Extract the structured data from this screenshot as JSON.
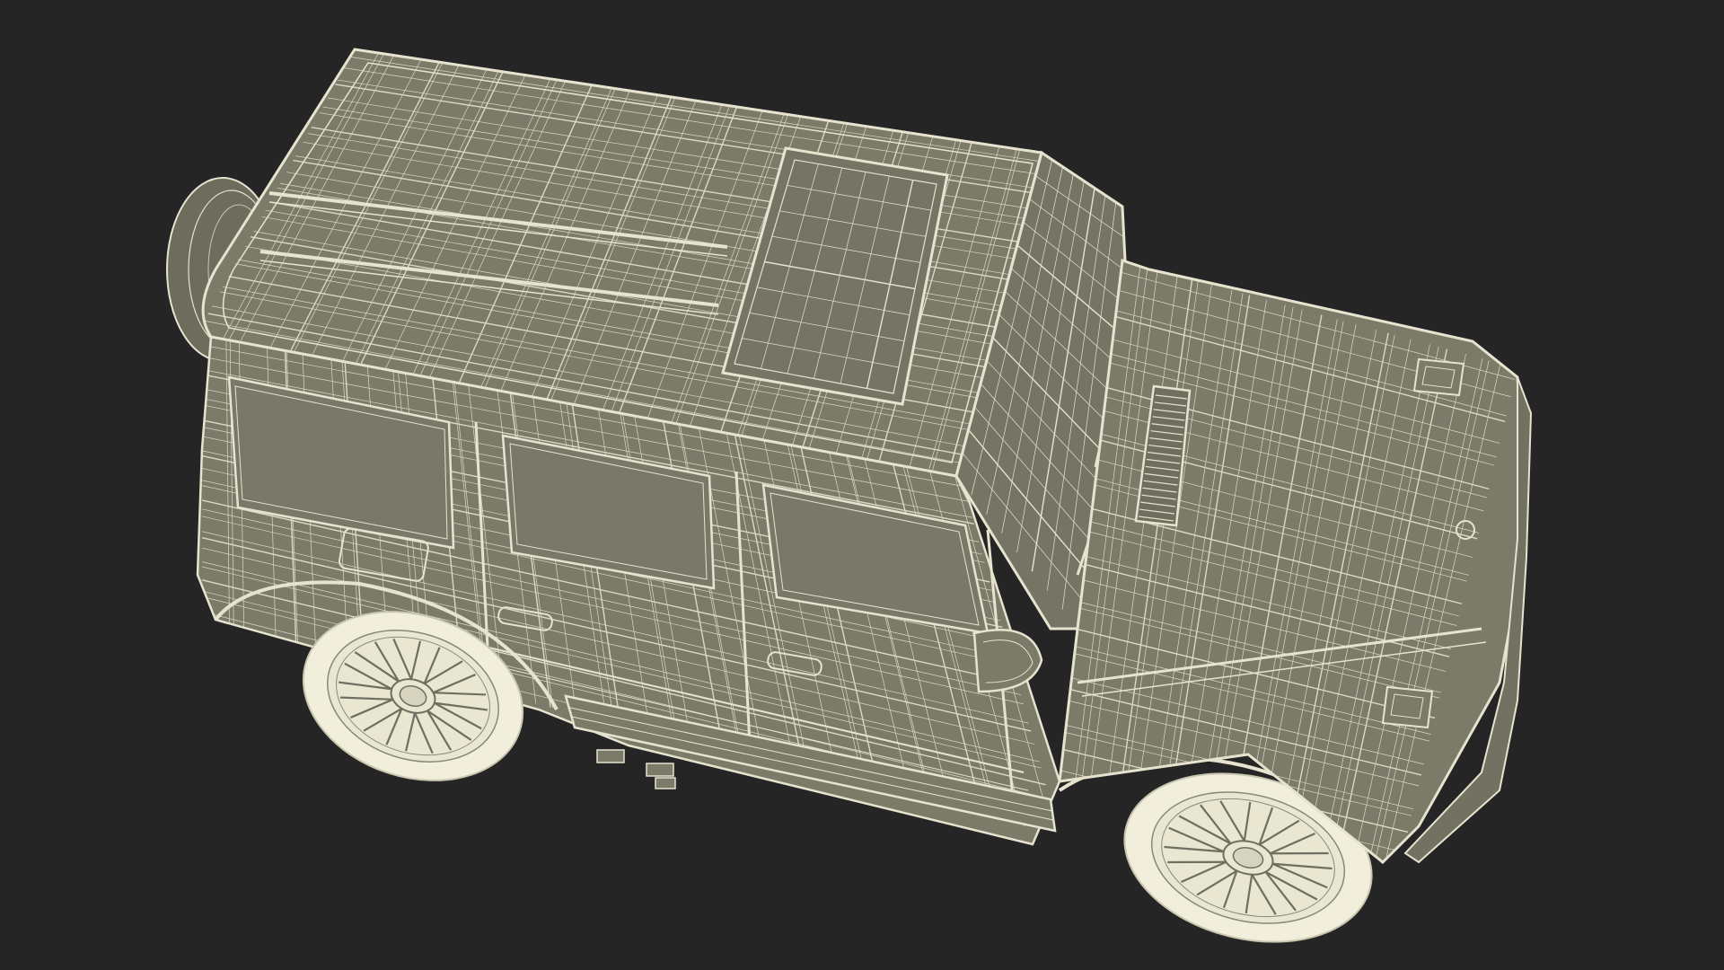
{
  "scene": {
    "subject": "suv-wireframe-model",
    "render_style": "wireframe",
    "colors": {
      "background": "#252525",
      "surface_fill": "#7c7b6a",
      "wire": "#e6e3cf",
      "wire_dim": "#c9c6b0",
      "tire": "#f1eedc",
      "shadow_fill": "#5f5e51"
    }
  }
}
